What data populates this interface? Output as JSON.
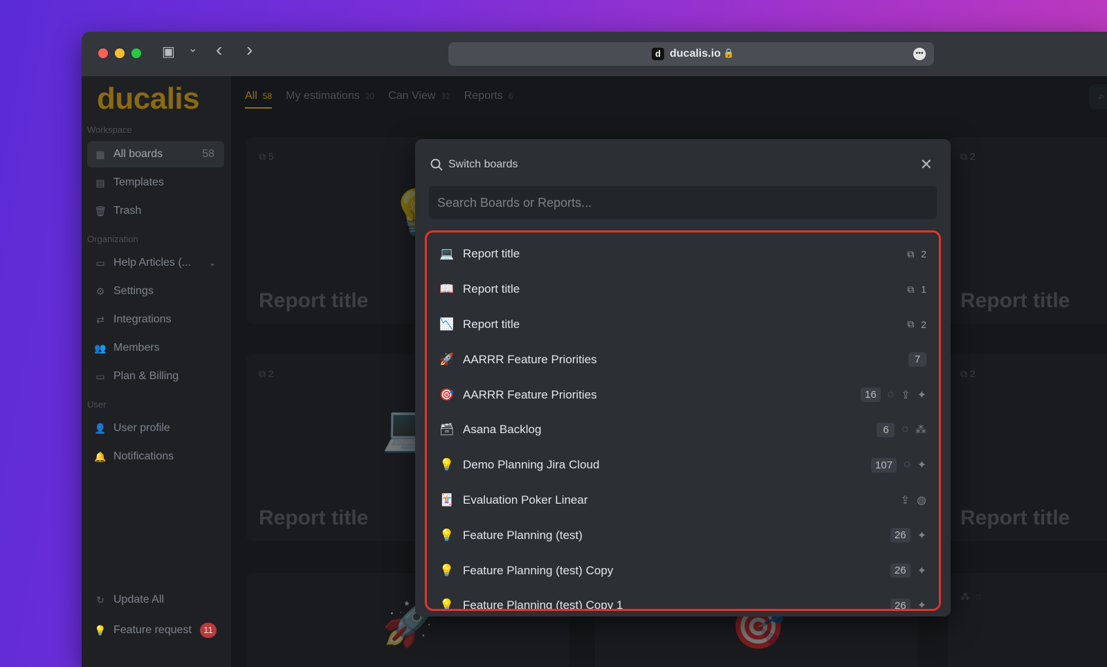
{
  "browser": {
    "favicon_letter": "d",
    "url": "ducalis.io",
    "lock": "🔒",
    "more": "•••",
    "sidebar_toggle": "▣",
    "dropdown": "⌄",
    "back": "‹",
    "forward": "›"
  },
  "sidebar": {
    "logo": "ducalis",
    "workspace_title": "Workspace",
    "organization_title": "Organization",
    "user_title": "User",
    "all_boards": {
      "label": "All boards",
      "count": "58",
      "icon": "grid-icon"
    },
    "templates": {
      "label": "Templates",
      "icon": "template-icon"
    },
    "trash": {
      "label": "Trash",
      "icon": "trash-icon"
    },
    "help_articles": {
      "label": "Help Articles (...",
      "icon": "folder-icon"
    },
    "settings": {
      "label": "Settings",
      "icon": "gear-icon"
    },
    "integrations": {
      "label": "Integrations",
      "icon": "sync-icon"
    },
    "members": {
      "label": "Members",
      "icon": "members-icon"
    },
    "plan_billing": {
      "label": "Plan & Billing",
      "icon": "card-icon"
    },
    "user_profile": {
      "label": "User profile",
      "icon": "user-icon"
    },
    "notifications": {
      "label": "Notifications",
      "icon": "bell-icon"
    },
    "update_all": {
      "label": "Update All",
      "icon": "refresh-icon"
    },
    "feature_request": {
      "label": "Feature request",
      "badge": "11",
      "icon": "bulb-icon"
    }
  },
  "tabs": [
    {
      "label": "All",
      "count": "58"
    },
    {
      "label": "My estimations",
      "count": "20"
    },
    {
      "label": "Can View",
      "count": "32"
    },
    {
      "label": "Reports",
      "count": "6"
    }
  ],
  "cards": {
    "share_1": "5",
    "share_2": "2",
    "share_3": "2",
    "share_4": "2",
    "title": "Report title"
  },
  "modal": {
    "heading": "Switch boards",
    "close": "✕",
    "search_placeholder": "Search Boards or Reports...",
    "rows": [
      {
        "emoji": "💻",
        "label": "Report title",
        "share": "2"
      },
      {
        "emoji": "📖",
        "label": "Report title",
        "share": "1"
      },
      {
        "emoji": "📉",
        "label": "Report title",
        "share": "2"
      },
      {
        "emoji": "🚀",
        "label": "AARRR Feature Priorities",
        "count": "7"
      },
      {
        "emoji": "🎯",
        "label": "AARRR Feature Priorities",
        "count": "16"
      },
      {
        "emoji": "🗃",
        "label": "Asana Backlog",
        "count": "6"
      },
      {
        "emoji": "💡",
        "label": "Demo Planning Jira Cloud",
        "count": "107"
      },
      {
        "emoji": "🃏",
        "label": "Evaluation Poker Linear"
      },
      {
        "emoji": "💡",
        "label": "Feature Planning (test)",
        "count": "26"
      },
      {
        "emoji": "💡",
        "label": "Feature Planning (test) Copy",
        "count": "26"
      },
      {
        "emoji": "💡",
        "label": "Feature Planning (test) Copy 1",
        "count": "26"
      }
    ]
  }
}
